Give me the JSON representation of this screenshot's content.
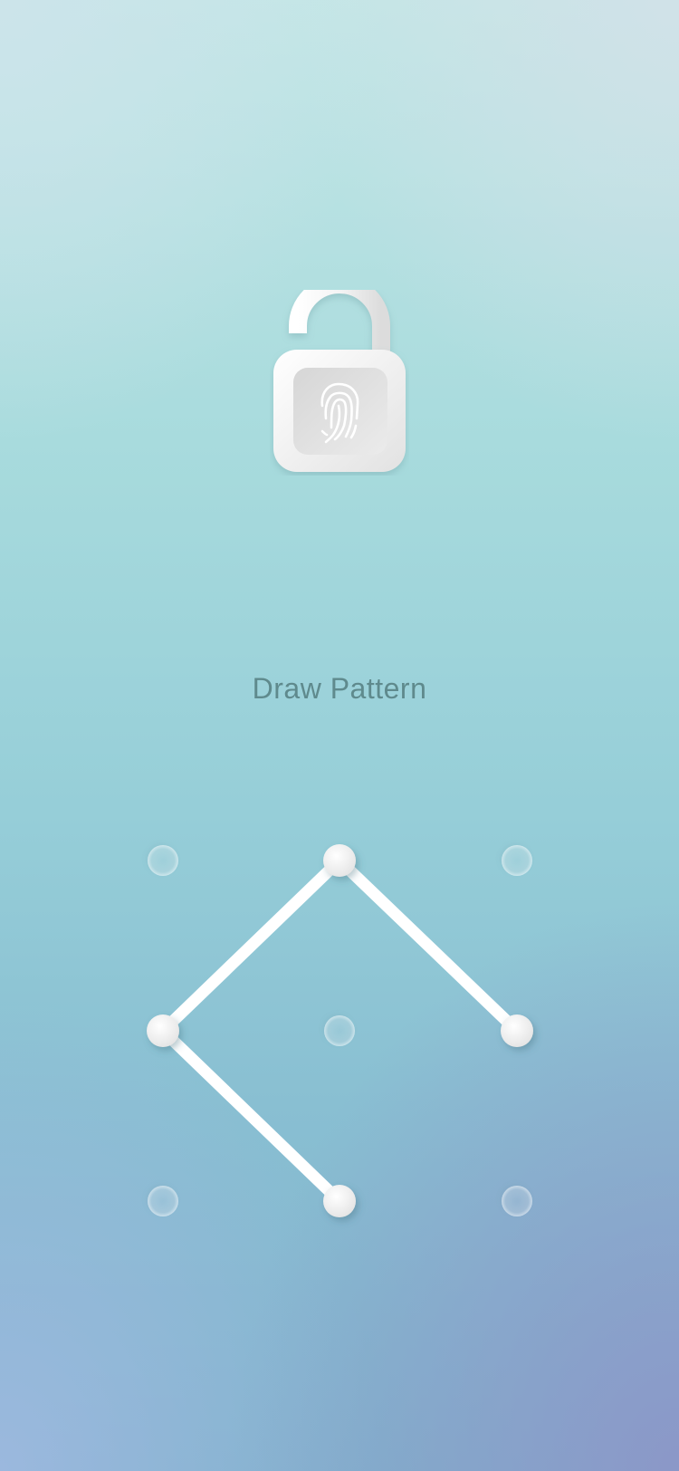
{
  "lock_screen": {
    "title": "Draw Pattern",
    "icon": "unlocked-padlock-fingerprint-icon"
  },
  "pattern_grid": {
    "rows": 3,
    "columns": 3,
    "dots": [
      {
        "id": "dot-1",
        "row": 1,
        "col": 1,
        "selected": false
      },
      {
        "id": "dot-2",
        "row": 1,
        "col": 2,
        "selected": true
      },
      {
        "id": "dot-3",
        "row": 1,
        "col": 3,
        "selected": false
      },
      {
        "id": "dot-4",
        "row": 2,
        "col": 1,
        "selected": true
      },
      {
        "id": "dot-5",
        "row": 2,
        "col": 2,
        "selected": false
      },
      {
        "id": "dot-6",
        "row": 2,
        "col": 3,
        "selected": true
      },
      {
        "id": "dot-7",
        "row": 3,
        "col": 1,
        "selected": false
      },
      {
        "id": "dot-8",
        "row": 3,
        "col": 2,
        "selected": true
      },
      {
        "id": "dot-9",
        "row": 3,
        "col": 3,
        "selected": false
      }
    ],
    "drawn_path": [
      "dot-6",
      "dot-2",
      "dot-4",
      "dot-8"
    ]
  },
  "colors": {
    "title_text": "#5f8a8d",
    "line": "#ffffff",
    "selected_dot": "#f3f3f3",
    "lock_body": "#f1f1f1"
  }
}
